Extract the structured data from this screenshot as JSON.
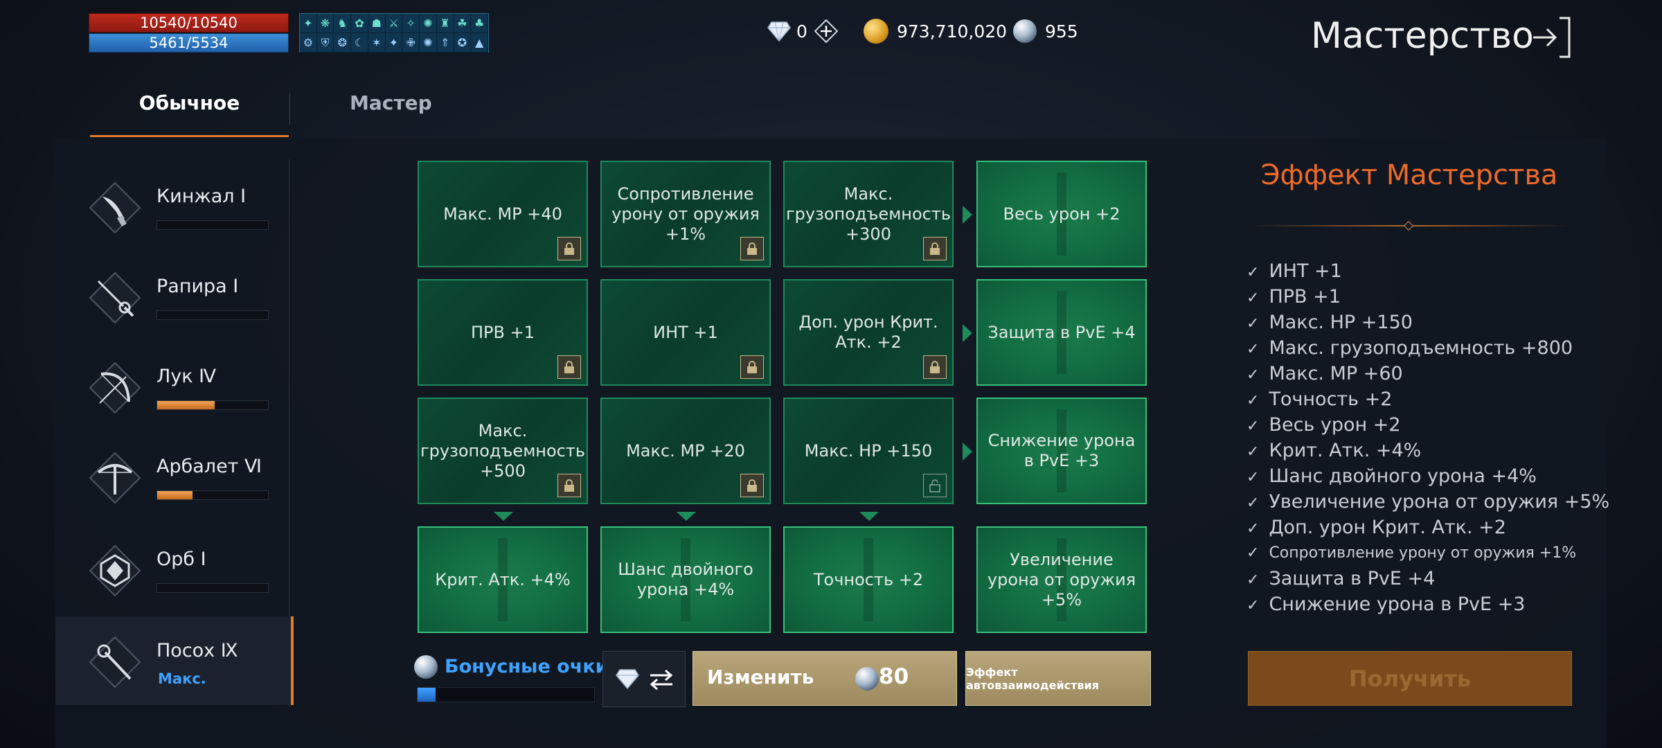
{
  "status": {
    "hp": "10540/10540",
    "mp": "5461/5534"
  },
  "buffs_row1": [
    "✦",
    "❋",
    "♞",
    "✿",
    "☗",
    "⚔",
    "✧",
    "✺",
    "♜",
    "☘",
    "♣"
  ],
  "buffs_row2": [
    "⚙",
    "⛨",
    "❂",
    "☾",
    "✶",
    "✦",
    "✙",
    "✺",
    "⇑",
    "✪",
    "▲"
  ],
  "currency": {
    "gems": "0",
    "gold": "973,710,020",
    "orbs": "955"
  },
  "page_title": "Мастерство",
  "tabs": {
    "normal": "Обычное",
    "master": "Мастер"
  },
  "weapons": [
    {
      "name": "Кинжал Ⅰ",
      "progress": 0
    },
    {
      "name": "Рапира Ⅰ",
      "progress": 0
    },
    {
      "name": "Лук Ⅳ",
      "progress": 0.52
    },
    {
      "name": "Арбалет Ⅵ",
      "progress": 0.32
    },
    {
      "name": "Орб Ⅰ",
      "progress": 0
    },
    {
      "name": "Посох Ⅸ",
      "max": "Макс."
    }
  ],
  "grid": {
    "r1": [
      "Макс. MP +40",
      "Сопротивление урону от оружия +1%",
      "Макс. грузоподъемность +300",
      "Весь урон +2"
    ],
    "r2": [
      "ПРВ +1",
      "ИНТ +1",
      "Доп. урон Крит. Атк. +2",
      "Защита в PvE +4"
    ],
    "r3": [
      "Макс. грузоподъемность +500",
      "Макс. MP +20",
      "Макс. HP +150",
      "Снижение урона в PvE +3"
    ],
    "r4": [
      "Крит. Атк. +4%",
      "Шанс двойного урона +4%",
      "Точность +2",
      "Увеличение урона от оружия +5%"
    ]
  },
  "bottom": {
    "bonus_label": "Бонусные очки",
    "bonus_progress": 0.1,
    "change_label": "Изменить",
    "change_cost": "80",
    "auto_label": "Эффект автовзаимодействия"
  },
  "effect": {
    "title": "Эффект Мастерства",
    "items": [
      "ИНТ +1",
      "ПРВ +1",
      "Макс. HP +150",
      "Макс. грузоподъемность +800",
      "Макс. MP +60",
      "Точность +2",
      "Весь урон +2",
      "Крит. Атк. +4%",
      "Шанс двойного урона +4%",
      "Увеличение урона от оружия +5%",
      "Доп. урон Крит. Атк. +2",
      "Сопротивление урону от оружия +1%",
      "Защита в PvE +4",
      "Снижение урона в PvE +3"
    ],
    "claim_label": "Получить"
  },
  "colors": {
    "accent": "#e07a2a",
    "highlight_blue": "#3fa2ff",
    "cell_border": "#1f8a5c",
    "cell_done": "#36c17a"
  }
}
